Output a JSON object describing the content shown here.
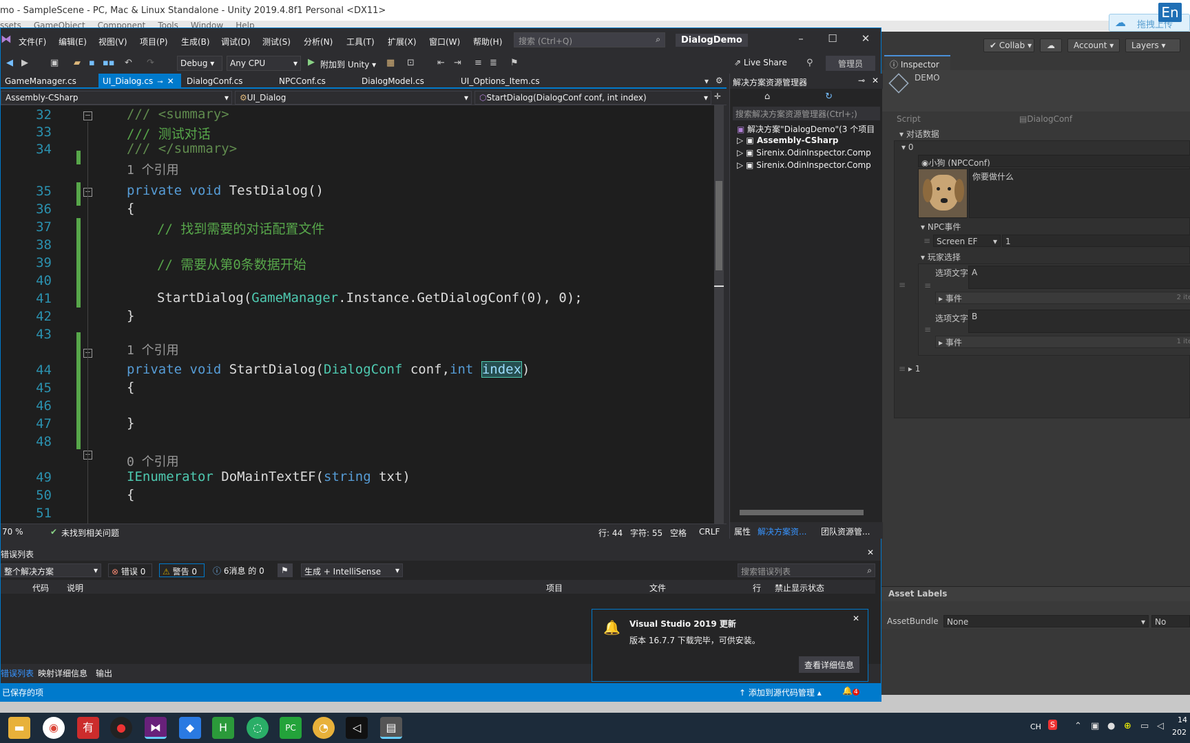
{
  "unity": {
    "title": "mo - SampleScene - PC, Mac & Linux Standalone - Unity 2019.4.8f1 Personal <DX11>",
    "menu": [
      "ssets",
      "GameObject",
      "Component",
      "Tools",
      "Window",
      "Help"
    ],
    "upload_label": "拖拽上传",
    "en_badge": "En",
    "collab_label": "Collab",
    "account_label": "Account",
    "layers_label": "Layers",
    "inspector": {
      "tab_label": "Inspector",
      "object_name": "DEMO",
      "script_label": "Script",
      "script_value": "DialogConf",
      "dialog_data_label": "对话数据",
      "element_0_label": "0",
      "npc_label": "小狗 (NPCConf)",
      "dialog_text": "你要做什么",
      "npc_event_label": "NPC事件",
      "npc_event_type": "Screen EF",
      "npc_event_value": "1",
      "player_choice_label": "玩家选择",
      "option_text_label_a": "选项文字",
      "option_text_value_a": "A",
      "event_label_a": "事件",
      "event_count_a": "2 ite",
      "option_text_label_b": "选项文字",
      "option_text_value_b": "B",
      "event_label_b": "事件",
      "event_count_b": "1 ite",
      "element_1_label": "1",
      "asset_labels": "Asset Labels",
      "asset_bundle_label": "AssetBundle",
      "asset_bundle_value": "None",
      "asset_bundle_variant": "No"
    }
  },
  "vs": {
    "menu": [
      "文件(F)",
      "编辑(E)",
      "视图(V)",
      "项目(P)",
      "生成(B)",
      "调试(D)",
      "测试(S)",
      "分析(N)",
      "工具(T)",
      "扩展(X)",
      "窗口(W)",
      "帮助(H)"
    ],
    "search_placeholder": "搜索 (Ctrl+Q)",
    "window_title": "DialogDemo",
    "config": "Debug",
    "platform": "Any CPU",
    "attach_label": "附加到 Unity",
    "live_share": "Live Share",
    "admin_label": "管理员",
    "tabs": [
      "GameManager.cs",
      "UI_Dialog.cs",
      "DialogConf.cs",
      "NPCConf.cs",
      "DialogModel.cs",
      "UI_Options_Item.cs"
    ],
    "nav": {
      "project": "Assembly-CSharp",
      "class": "UI_Dialog",
      "member": "StartDialog(DialogConf conf, int index)"
    },
    "code": {
      "l32": "/// <summary>",
      "l33": "/// 测试对话",
      "l34": "/// </summary>",
      "ref1": "1 个引用",
      "l35_kw": "private void ",
      "l35_name": "TestDialog()",
      "l36": "{",
      "l37": "// 找到需要的对话配置文件",
      "l39": "// 需要从第0条数据开始",
      "l41_a": "StartDialog(",
      "l41_b": "GameManager",
      "l41_c": ".Instance.GetDialogConf(0), 0);",
      "l42": "}",
      "ref2": "1 个引用",
      "l44_kw": "private void ",
      "l44_name": "StartDialog(",
      "l44_type": "DialogConf",
      "l44_rest1": " conf,",
      "l44_int": "int",
      "l44_idx": "index",
      "l44_end": ")",
      "l45": "{",
      "l47": "}",
      "ref3": "0 个引用",
      "l49_type": "IEnumerator",
      "l49_name": " DoMainTextEF(",
      "l49_str": "string",
      "l49_rest": " txt)",
      "l50": "{",
      "lines": [
        "32",
        "33",
        "34",
        "35",
        "36",
        "37",
        "38",
        "39",
        "40",
        "41",
        "42",
        "43",
        "44",
        "45",
        "46",
        "47",
        "48",
        "49",
        "50",
        "51"
      ]
    },
    "status_edit": {
      "zoom": "70 %",
      "issues": "未找到相关问题",
      "line": "行: 44",
      "col": "字符: 55",
      "space": "空格",
      "eol": "CRLF"
    },
    "solution": {
      "title": "解决方案资源管理器",
      "search_placeholder": "搜索解决方案资源管理器(Ctrl+;)",
      "root": "解决方案\"DialogDemo\"(3 个项目",
      "items": [
        "Assembly-CSharp",
        "Sirenix.OdinInspector.Comp",
        "Sirenix.OdinInspector.Comp"
      ],
      "bottom_tabs": [
        "属性",
        "解决方案资...",
        "团队资源管..."
      ]
    },
    "errors": {
      "title": "错误列表",
      "scope": "整个解决方案",
      "errors": "错误 0",
      "warnings": "警告 0",
      "messages": "6消息 的 0",
      "build": "生成 + IntelliSense",
      "search_placeholder": "搜索错误列表",
      "cols": [
        "代码",
        "说明",
        "项目",
        "文件",
        "行",
        "禁止显示状态"
      ],
      "bottom_tabs": [
        "错误列表",
        "映射详细信息",
        "输出"
      ]
    },
    "notification": {
      "title": "Visual Studio 2019 更新",
      "body": "版本 16.7.7 下载完毕，可供安装。",
      "button": "查看详细信息"
    },
    "statusbar": {
      "saved": "已保存的项",
      "source_control": "添加到源代码管理",
      "notif_count": "4"
    }
  },
  "taskbar": {
    "tray_lang": "CH",
    "clock": "14",
    "date": "202"
  }
}
